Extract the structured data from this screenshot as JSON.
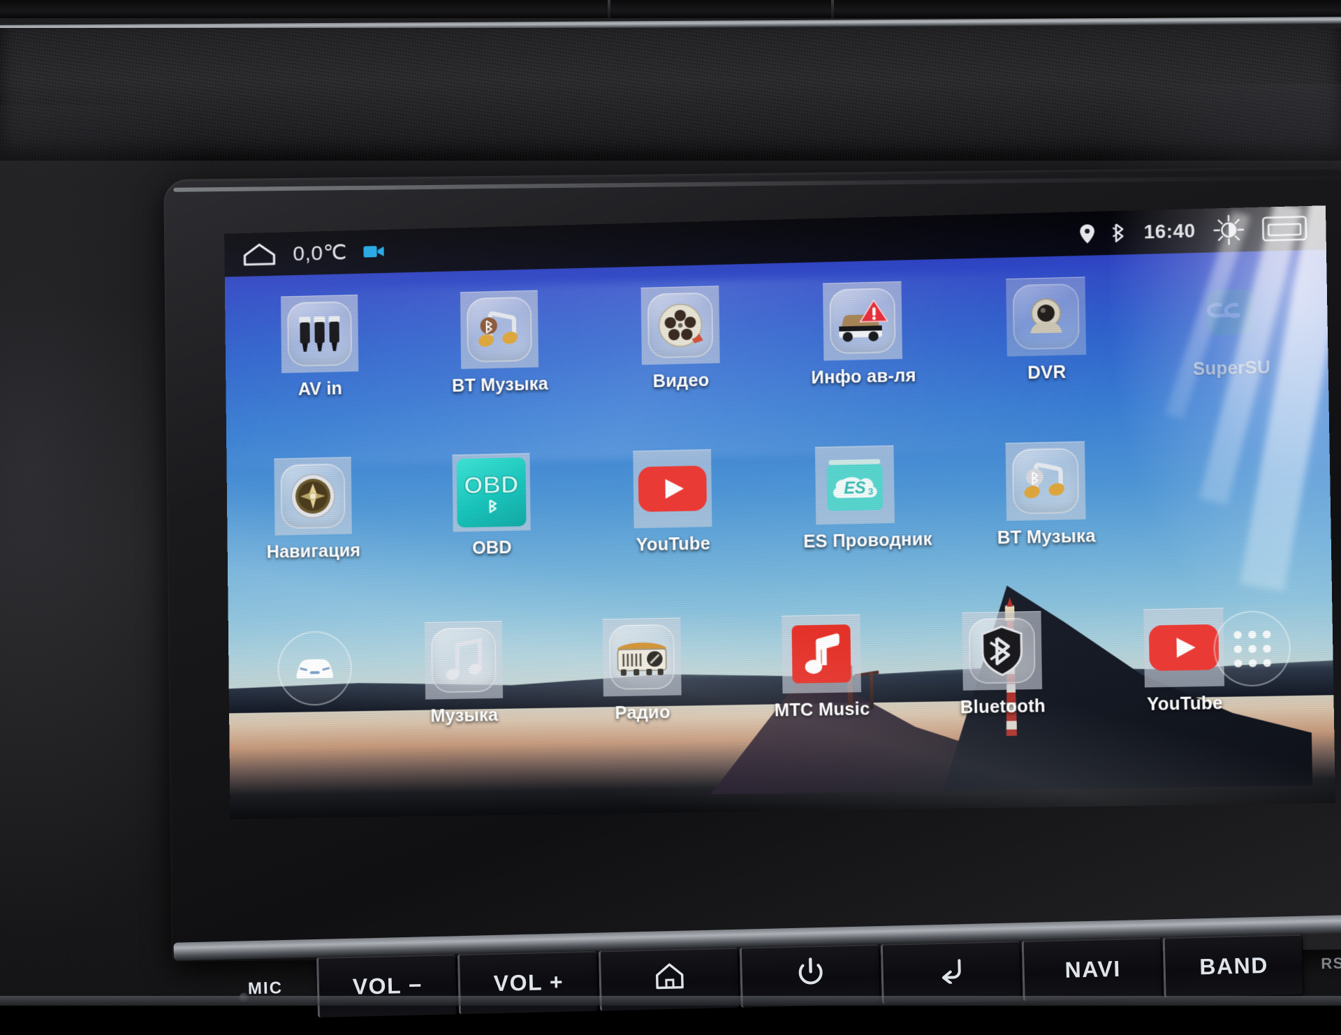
{
  "device": {
    "type": "android-car-head-unit",
    "screen_label": "home-launcher"
  },
  "statusbar": {
    "home_icon": "home-outline-icon",
    "temperature": "0,0℃",
    "camera_icon": "video-camera-icon",
    "location_icon": "location-pin-icon",
    "bluetooth_icon": "bluetooth-icon",
    "clock": "16:40",
    "brightness_icon": "brightness-sun-icon",
    "screen_icon": "screen-off-icon"
  },
  "apps": {
    "row1": [
      {
        "label": "AV in",
        "icon": "rca-connectors-icon",
        "style": "plate"
      },
      {
        "label": "BT Музыка",
        "icon": "bluetooth-music-note-icon",
        "style": "plate"
      },
      {
        "label": "Видео",
        "icon": "film-reel-icon",
        "style": "plate"
      },
      {
        "label": "Инфо ав-ля",
        "icon": "car-warning-icon",
        "style": "plate"
      },
      {
        "label": "DVR",
        "icon": "dashcam-icon",
        "style": "plate"
      },
      {
        "label": "SuperSU",
        "icon": "supersu-icon",
        "style": "glare-hidden"
      }
    ],
    "row2": [
      {
        "label": "Навигация",
        "icon": "compass-icon",
        "style": "plate"
      },
      {
        "label": "OBD",
        "icon": "obd-icon",
        "style": "color",
        "color": "#2ad6cf"
      },
      {
        "label": "YouTube",
        "icon": "youtube-icon",
        "style": "color",
        "color": "#ee3b36"
      },
      {
        "label": "ES Проводник",
        "icon": "es-file-explorer-icon",
        "style": "color",
        "color": "#4fd2cd"
      },
      {
        "label": "BT Музыка",
        "icon": "bluetooth-music-note-icon",
        "style": "plate"
      }
    ],
    "row3": [
      {
        "label": "Музыка",
        "icon": "music-note-icon",
        "style": "plate"
      },
      {
        "label": "Радио",
        "icon": "retro-radio-icon",
        "style": "plate"
      },
      {
        "label": "MTC Music",
        "icon": "mts-music-icon",
        "style": "color",
        "color": "#e8332a"
      },
      {
        "label": "Bluetooth",
        "icon": "bluetooth-shield-icon",
        "style": "plate"
      },
      {
        "label": "YouTube",
        "icon": "youtube-icon",
        "style": "color",
        "color": "#ee3b36"
      }
    ]
  },
  "dock": {
    "left_button": {
      "label": "",
      "icon": "car-front-icon"
    },
    "right_button": {
      "label": "",
      "icon": "app-drawer-grid-icon"
    }
  },
  "hardware_buttons": [
    {
      "label": "MIC",
      "icon": "microphone-icon",
      "type": "text"
    },
    {
      "label": "VOL −",
      "icon": "volume-down-icon",
      "type": "text"
    },
    {
      "label": "VOL +",
      "icon": "volume-up-icon",
      "type": "text"
    },
    {
      "label": "",
      "icon": "home-icon",
      "type": "icon"
    },
    {
      "label": "",
      "icon": "power-icon",
      "type": "icon"
    },
    {
      "label": "",
      "icon": "back-arrow-icon",
      "type": "icon"
    },
    {
      "label": "NAVI",
      "icon": "navi-icon",
      "type": "text"
    },
    {
      "label": "BAND",
      "icon": "band-icon",
      "type": "text"
    },
    {
      "label": "RST",
      "icon": "reset-icon",
      "type": "text"
    }
  ],
  "colors": {
    "wallpaper_sky_top": "#2a2bb4",
    "wallpaper_sky_mid": "#4f97d8",
    "wallpaper_sunset": "#d9c5ae",
    "youtube_red": "#ee3b36",
    "mts_red": "#e8332a",
    "obd_teal": "#2ad6cf",
    "es_teal": "#4fd2cd",
    "status_text": "#e3e6ea",
    "camera_blue": "#1fa8e8"
  }
}
